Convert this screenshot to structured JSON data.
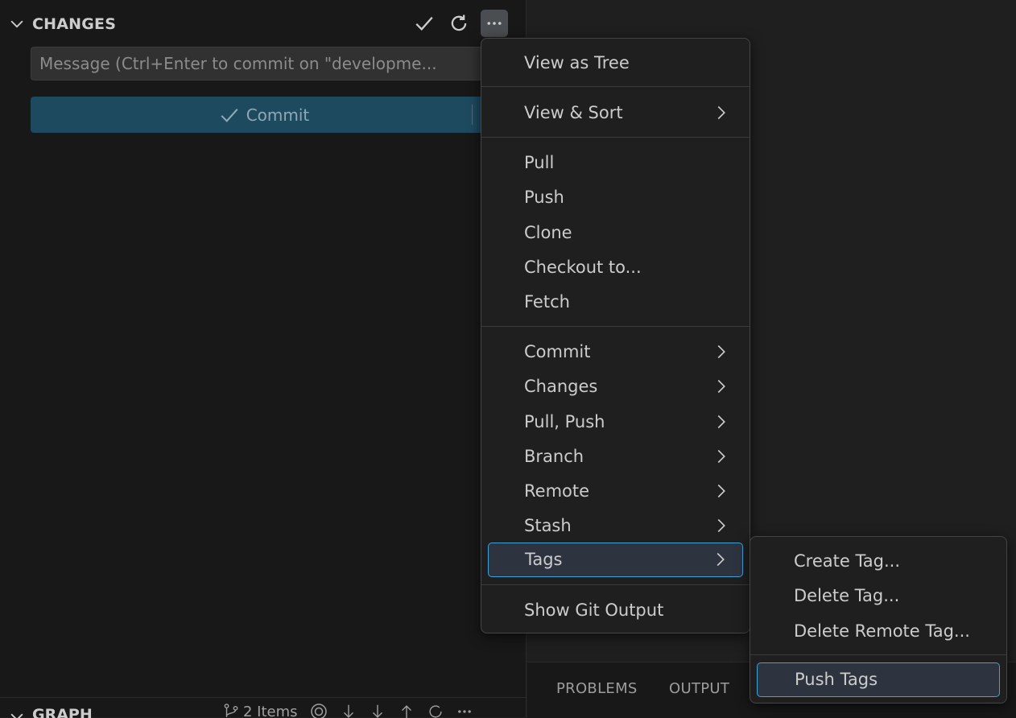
{
  "scm": {
    "section_title": "CHANGES",
    "message_placeholder": "Message (Ctrl+Enter to commit on \"developme...",
    "commit_label": "Commit"
  },
  "graph": {
    "title": "GRAPH",
    "items_label": "2 Items"
  },
  "panel": {
    "tabs": [
      "PROBLEMS",
      "OUTPUT"
    ]
  },
  "menu": {
    "items": [
      {
        "label": "View as Tree"
      },
      {
        "label": "View & Sort",
        "submenu": true
      },
      {
        "label": "Pull"
      },
      {
        "label": "Push"
      },
      {
        "label": "Clone"
      },
      {
        "label": "Checkout to..."
      },
      {
        "label": "Fetch"
      },
      {
        "label": "Commit",
        "submenu": true
      },
      {
        "label": "Changes",
        "submenu": true
      },
      {
        "label": "Pull, Push",
        "submenu": true
      },
      {
        "label": "Branch",
        "submenu": true
      },
      {
        "label": "Remote",
        "submenu": true
      },
      {
        "label": "Stash",
        "submenu": true
      },
      {
        "label": "Tags",
        "submenu": true,
        "selected": true
      },
      {
        "label": "Show Git Output"
      }
    ]
  },
  "tags_submenu": {
    "items": [
      {
        "label": "Create Tag..."
      },
      {
        "label": "Delete Tag..."
      },
      {
        "label": "Delete Remote Tag..."
      },
      {
        "label": "Push Tags",
        "selected": true
      }
    ]
  },
  "colors": {
    "accent_border": "#3fa3d8",
    "commit_button": "#1e4a60",
    "menu_background": "#1f1f1f"
  }
}
